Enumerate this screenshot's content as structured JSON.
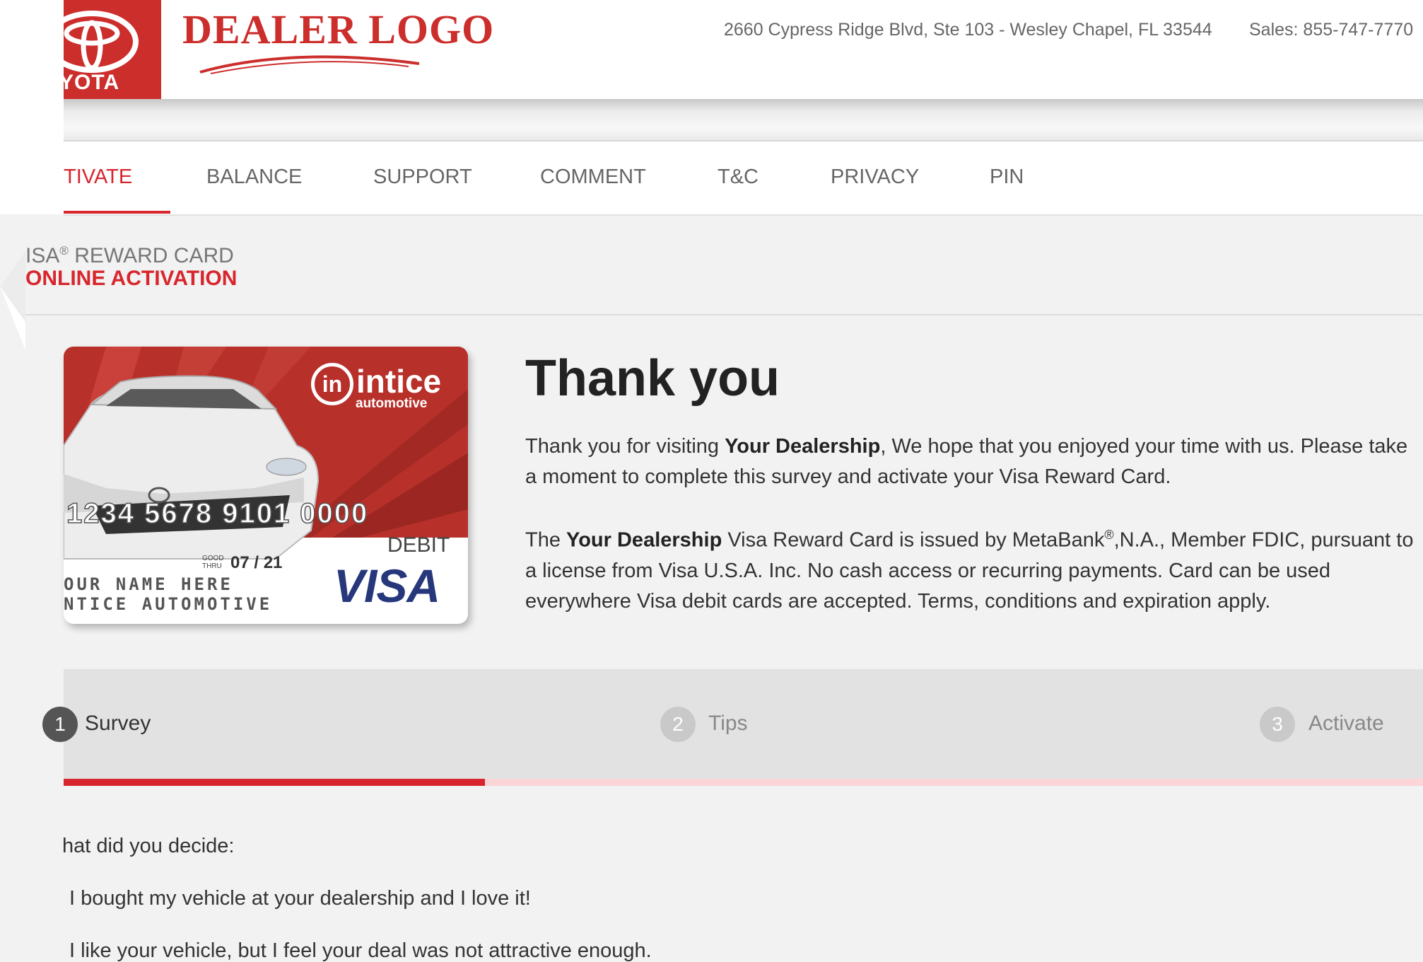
{
  "header": {
    "brand_text": "YOTA",
    "dealer_logo": "DEALER LOGO",
    "address": "2660 Cypress Ridge Blvd, Ste 103 - Wesley Chapel, FL  33544",
    "sales": "Sales:  855-747-7770"
  },
  "nav": {
    "items": [
      {
        "label": "TIVATE"
      },
      {
        "label": "BALANCE"
      },
      {
        "label": "SUPPORT"
      },
      {
        "label": "COMMENT"
      },
      {
        "label": "T&C"
      },
      {
        "label": "PRIVACY"
      },
      {
        "label": "PIN"
      }
    ]
  },
  "title": {
    "line1_prefix": "ISA",
    "line1_sup": "®",
    "line1_suffix": " REWARD CARD",
    "line2": "ONLINE ACTIVATION"
  },
  "card": {
    "brand": "intice",
    "brand_sub": "automotive",
    "number": "1234 5678 9101 0000",
    "type": "DEBIT",
    "good_thru_1": "GOOD",
    "good_thru_2": "THRU",
    "expiry": "07 / 21",
    "name": "OUR NAME HERE",
    "company": "NTICE AUTOMOTIVE",
    "network": "VISA"
  },
  "thankyou": {
    "title": "Thank you",
    "p1_a": "Thank you for visiting ",
    "p1_b": "Your Dealership",
    "p1_c": ", We hope that you enjoyed your time with us. Please take a moment to complete this survey and activate your Visa Reward Card.",
    "p2_a": "The ",
    "p2_b": "Your Dealership",
    "p2_c": " Visa Reward Card is issued by MetaBank",
    "p2_sup": "®",
    "p2_d": ",N.A., Member FDIC, pursuant to a license from Visa U.S.A. Inc. No cash access or recurring payments. Card can be used everywhere Visa debit cards are accepted. Terms, conditions and expiration apply."
  },
  "steps": {
    "items": [
      {
        "num": "1",
        "label": "Survey"
      },
      {
        "num": "2",
        "label": "Tips"
      },
      {
        "num": "3",
        "label": "Activate"
      }
    ],
    "progress": 0.31
  },
  "survey": {
    "question": "hat did you decide:",
    "options": [
      "I bought my vehicle at your dealership and I love it!",
      "I like your vehicle, but I feel your deal was not attractive enough."
    ]
  },
  "colors": {
    "accent": "#d7262d",
    "brand_red": "#cc2e2c",
    "visa_blue": "#26377c"
  }
}
